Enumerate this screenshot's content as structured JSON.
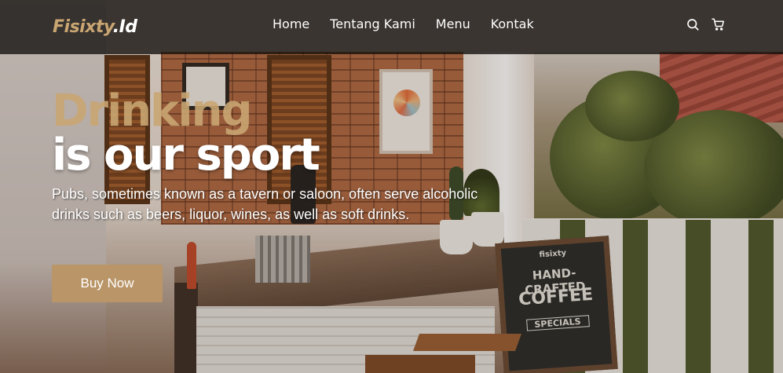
{
  "navbar": {
    "logo_main": "Fisixty",
    "logo_suffix": ".Id",
    "links": [
      "Home",
      "Tentang Kami",
      "Menu",
      "Kontak"
    ],
    "icons": [
      "search-icon",
      "cart-icon"
    ]
  },
  "hero": {
    "heading_accent": "Drinking",
    "heading_main": "is our sport",
    "description": "Pubs, sometimes known as a tavern or saloon, often serve alcoholic drinks such as beers, liquor, wines, as well as soft drinks.",
    "button_label": "Buy Now"
  },
  "background": {
    "chalkboard": {
      "line1": "fisixty",
      "line2": "HAND-CRAFTED",
      "line3": "COFFEE",
      "line4": "SPECIALS"
    }
  },
  "colors": {
    "accent": "#b99568",
    "logo": "#c9a572",
    "navbar_bg": "#110e0c"
  }
}
